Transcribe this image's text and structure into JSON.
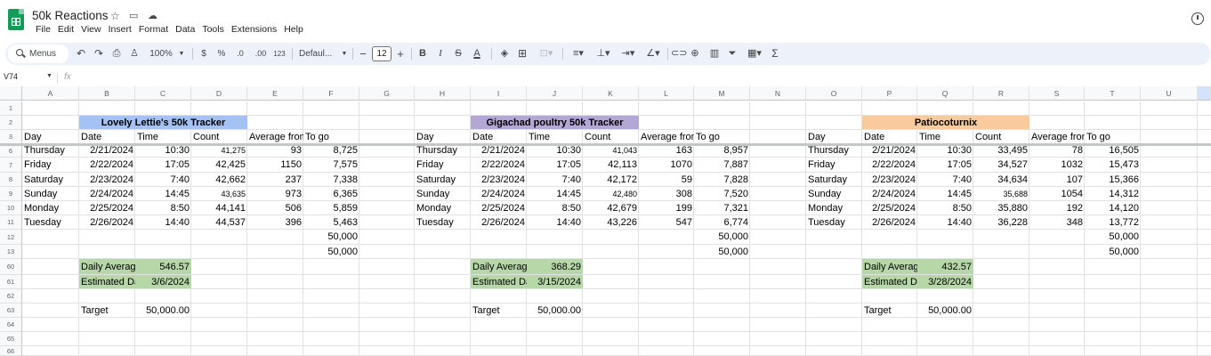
{
  "document": {
    "title": "50k Reactions",
    "menu": [
      "File",
      "Edit",
      "View",
      "Insert",
      "Format",
      "Data",
      "Tools",
      "Extensions",
      "Help"
    ]
  },
  "toolbar": {
    "search_label": "Menus",
    "zoom": "100%",
    "currency": "$",
    "percent": "%",
    "decrease_decimal": ".0",
    "increase_decimal": ".00",
    "number_format": "123",
    "font": "Defaul...",
    "font_size": "12",
    "bold": "B",
    "italic": "I",
    "strike": "S",
    "text_color": "A",
    "sum": "Σ"
  },
  "formula_bar": {
    "cell_ref": "V74",
    "fx": "fx"
  },
  "columns": [
    "A",
    "B",
    "C",
    "D",
    "E",
    "F",
    "G",
    "H",
    "I",
    "J",
    "K",
    "L",
    "M",
    "N",
    "O",
    "P",
    "Q",
    "R",
    "S",
    "T",
    "U",
    ""
  ],
  "rows": [
    "1",
    "2",
    "3",
    "6",
    "7",
    "8",
    "9",
    "10",
    "11",
    "12",
    "13",
    "60",
    "61",
    "62",
    "63",
    "64",
    "65",
    "66"
  ],
  "headers": [
    "Day",
    "Date",
    "Time",
    "Count",
    "Average from",
    "To go"
  ],
  "summary_labels": {
    "daily_average": "Daily Average",
    "estimated_date": "Estimated Date",
    "target": "Target"
  },
  "trackers": [
    {
      "title": "Lovely Lettie's 50k Tracker",
      "color": "#a4c2f4",
      "rows": [
        [
          "Thursday",
          "2/21/2024",
          "10:30",
          "41,275",
          "93",
          "8,725"
        ],
        [
          "Friday",
          "2/22/2024",
          "17:05",
          "42,425",
          "1150",
          "7,575"
        ],
        [
          "Saturday",
          "2/23/2024",
          "7:40",
          "42,662",
          "237",
          "7,338"
        ],
        [
          "Sunday",
          "2/24/2024",
          "14:45",
          "43,635",
          "973",
          "6,365"
        ],
        [
          "Monday",
          "2/25/2024",
          "8:50",
          "44,141",
          "506",
          "5,859"
        ],
        [
          "Tuesday",
          "2/26/2024",
          "14:40",
          "44,537",
          "396",
          "5,463"
        ]
      ],
      "extra_to_go": [
        "50,000",
        "50,000"
      ],
      "daily_average": "546.57",
      "estimated_date": "3/6/2024",
      "target": "50,000.00"
    },
    {
      "title": "Gigachad poultry 50k Tracker",
      "color": "#b4a7d6",
      "rows": [
        [
          "Thursday",
          "2/21/2024",
          "10:30",
          "41,043",
          "163",
          "8,957"
        ],
        [
          "Friday",
          "2/22/2024",
          "17:05",
          "42,113",
          "1070",
          "7,887"
        ],
        [
          "Saturday",
          "2/23/2024",
          "7:40",
          "42,172",
          "59",
          "7,828"
        ],
        [
          "Sunday",
          "2/24/2024",
          "14:45",
          "42,480",
          "308",
          "7,520"
        ],
        [
          "Monday",
          "2/25/2024",
          "8:50",
          "42,679",
          "199",
          "7,321"
        ],
        [
          "Tuesday",
          "2/26/2024",
          "14:40",
          "43,226",
          "547",
          "6,774"
        ]
      ],
      "extra_to_go": [
        "50,000",
        "50,000"
      ],
      "daily_average": "368.29",
      "estimated_date": "3/15/2024",
      "target": "50,000.00"
    },
    {
      "title": "Patiocoturnix",
      "color": "#f9cb9c",
      "rows": [
        [
          "Thursday",
          "2/21/2024",
          "10:30",
          "33,495",
          "78",
          "16,505"
        ],
        [
          "Friday",
          "2/22/2024",
          "17:05",
          "34,527",
          "1032",
          "15,473"
        ],
        [
          "Saturday",
          "2/23/2024",
          "7:40",
          "34,634",
          "107",
          "15,366"
        ],
        [
          "Sunday",
          "2/24/2024",
          "14:45",
          "35,688",
          "1054",
          "14,312"
        ],
        [
          "Monday",
          "2/25/2024",
          "8:50",
          "35,880",
          "192",
          "14,120"
        ],
        [
          "Tuesday",
          "2/26/2024",
          "14:40",
          "36,228",
          "348",
          "13,772"
        ]
      ],
      "extra_to_go": [
        "50,000",
        "50,000"
      ],
      "daily_average": "432.57",
      "estimated_date": "3/28/2024",
      "target": "50,000.00"
    }
  ]
}
